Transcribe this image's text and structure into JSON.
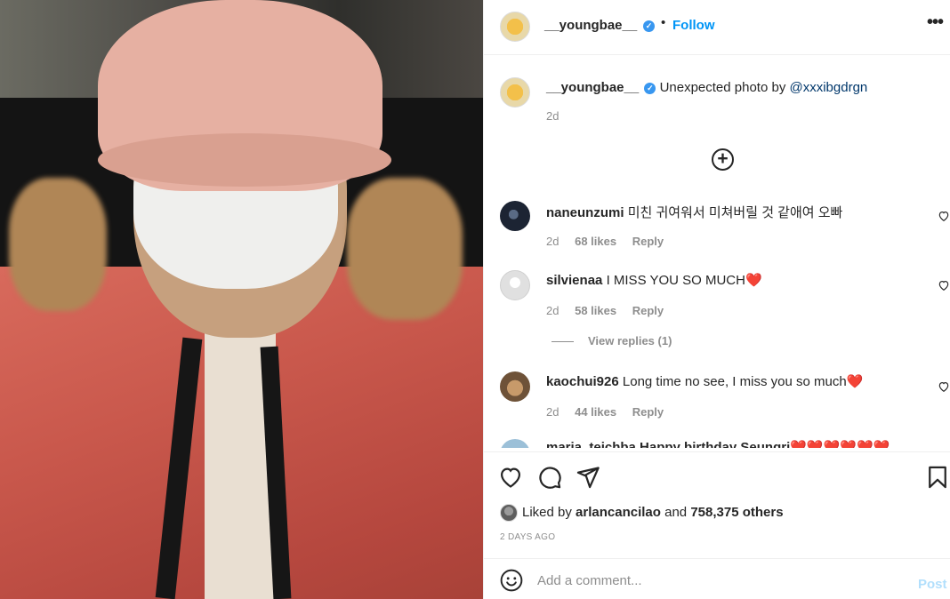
{
  "photo": {
    "description_icon": "post-photo"
  },
  "header": {
    "username": "__youngbae__",
    "verified_icon": "verified-badge-icon",
    "separator": "•",
    "follow_label": "Follow",
    "more_icon": "more-options-icon",
    "more_label": "•••"
  },
  "caption": {
    "username": "__youngbae__",
    "text": "Unexpected photo by ",
    "mention": "@xxxibgdrgn",
    "time": "2d"
  },
  "load_more_label": "+",
  "comments": [
    {
      "username": "naneunzumi",
      "text": "미친 귀여워서 미쳐버릴 것 같애여 오빠",
      "time": "2d",
      "likes": "68 likes",
      "reply": "Reply"
    },
    {
      "username": "silvienaa",
      "text": "I MISS YOU SO MUCH",
      "emoji": "❤️",
      "time": "2d",
      "likes": "58 likes",
      "reply": "Reply"
    },
    {
      "username": "kaochui926",
      "text": "Long time no see, I miss you so much",
      "emoji": "❤️",
      "time": "2d",
      "likes": "44 likes",
      "reply": "Reply"
    }
  ],
  "view_replies": "View replies (1)",
  "peek_comment": "maria_teichba Happy birthday Seungri❤️❤️❤️❤️❤️❤️",
  "actions": {
    "like_icon": "heart-icon",
    "comment_icon": "comment-icon",
    "share_icon": "share-icon",
    "save_icon": "bookmark-icon"
  },
  "likes": {
    "prefix": "Liked by ",
    "user": "arlancancilao",
    "middle": " and ",
    "count": "758,375 others"
  },
  "post_time": "2 DAYS AGO",
  "add_comment": {
    "placeholder": "Add a comment...",
    "post_label": "Post",
    "emoji_icon": "emoji-icon"
  },
  "colors": {
    "accent": "#0095f6",
    "verified": "#3897f0",
    "heart": "#ed4956",
    "muted": "#8e8e8e",
    "post_disabled": "#b2dffc"
  }
}
